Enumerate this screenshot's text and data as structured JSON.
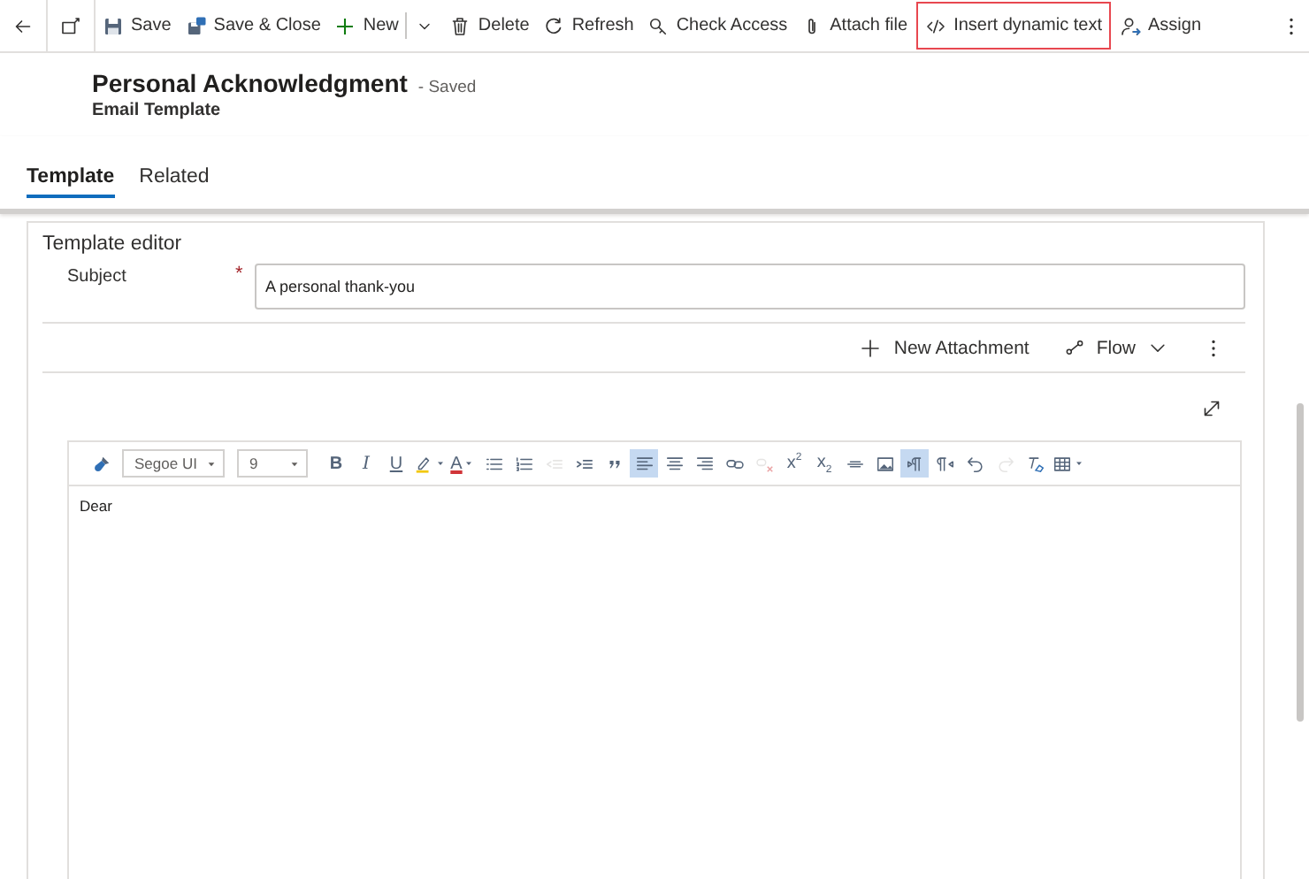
{
  "command_bar": {
    "commands": [
      {
        "kind": "back",
        "highlighted": false
      },
      {
        "kind": "popout",
        "highlighted": false
      },
      {
        "kind": "save",
        "label": "Save",
        "highlighted": false
      },
      {
        "kind": "save-close",
        "label": "Save & Close",
        "highlighted": false
      },
      {
        "kind": "new",
        "label": "New",
        "highlighted": false
      },
      {
        "kind": "split-chevron",
        "highlighted": false
      },
      {
        "kind": "delete",
        "label": "Delete",
        "highlighted": false
      },
      {
        "kind": "refresh",
        "label": "Refresh",
        "highlighted": false
      },
      {
        "kind": "check-access",
        "label": "Check Access",
        "highlighted": false
      },
      {
        "kind": "attach",
        "label": "Attach file",
        "highlighted": false
      },
      {
        "kind": "code",
        "label": "Insert dynamic text",
        "highlighted": true
      },
      {
        "kind": "assign",
        "label": "Assign",
        "highlighted": false
      },
      {
        "kind": "more",
        "highlighted": false
      }
    ]
  },
  "header": {
    "title": "Personal Acknowledgment",
    "save_status": "- Saved",
    "entity": "Email Template"
  },
  "tabs": [
    {
      "label": "Template",
      "selected": true
    },
    {
      "label": "Related",
      "selected": false
    }
  ],
  "section": {
    "title": "Template editor",
    "subject": {
      "label": "Subject",
      "required_mark": "*",
      "value": "A personal thank-you"
    },
    "attachment_bar": [
      {
        "kind": "add",
        "label": "New Attachment"
      },
      {
        "kind": "flow",
        "label": "Flow"
      },
      {
        "kind": "more"
      }
    ],
    "editor": {
      "tools": [
        {
          "kind": "brush",
          "active": false,
          "disabled": false
        },
        {
          "kind": "dropdown",
          "value": "Segoe UI"
        },
        {
          "kind": "dropdown",
          "value": "9"
        },
        {
          "kind": "bold",
          "label": "B",
          "active": false,
          "disabled": false
        },
        {
          "kind": "italic",
          "label": "I",
          "active": false,
          "disabled": false
        },
        {
          "kind": "underline",
          "label": "U",
          "active": false,
          "disabled": false
        },
        {
          "kind": "highlight",
          "active": false,
          "disabled": false
        },
        {
          "kind": "font-color",
          "label": "A",
          "active": false,
          "disabled": false
        },
        {
          "kind": "bullets",
          "active": false,
          "disabled": false
        },
        {
          "kind": "numbers",
          "active": false,
          "disabled": false
        },
        {
          "kind": "outdent",
          "active": false,
          "disabled": true
        },
        {
          "kind": "indent",
          "active": false,
          "disabled": false
        },
        {
          "kind": "quote",
          "active": false,
          "disabled": false
        },
        {
          "kind": "align-left",
          "active": true,
          "disabled": false
        },
        {
          "kind": "align-center",
          "active": false,
          "disabled": false
        },
        {
          "kind": "align-right",
          "active": false,
          "disabled": false
        },
        {
          "kind": "link",
          "active": false,
          "disabled": false
        },
        {
          "kind": "unlink",
          "active": false,
          "disabled": true
        },
        {
          "kind": "superscript",
          "label": "x$^{2}$",
          "active": false,
          "disabled": false
        },
        {
          "kind": "subscript",
          "label": "x$_{2}$",
          "active": false,
          "disabled": false
        },
        {
          "kind": "strike",
          "active": false,
          "disabled": false
        },
        {
          "kind": "image",
          "active": false,
          "disabled": false
        },
        {
          "kind": "ltr",
          "active": true,
          "disabled": false
        },
        {
          "kind": "rtl",
          "active": false,
          "disabled": false
        },
        {
          "kind": "undo",
          "active": false,
          "disabled": false
        },
        {
          "kind": "redo",
          "active": false,
          "disabled": true
        },
        {
          "kind": "clear-format",
          "active": false,
          "disabled": false
        },
        {
          "kind": "table",
          "active": false,
          "disabled": false
        }
      ],
      "body": "Dear"
    }
  }
}
